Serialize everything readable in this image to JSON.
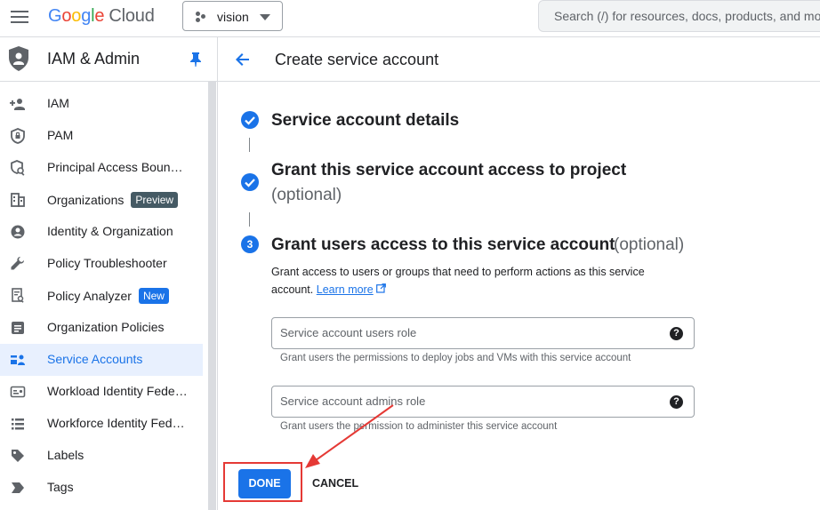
{
  "header": {
    "logo_google": [
      "G",
      "o",
      "o",
      "g",
      "l",
      "e"
    ],
    "logo_cloud": "Cloud",
    "project": "vision",
    "search_placeholder": "Search (/) for resources, docs, products, and mo"
  },
  "sidebar": {
    "title": "IAM & Admin",
    "items": [
      {
        "label": "IAM",
        "icon": "person-add-icon"
      },
      {
        "label": "PAM",
        "icon": "shield-lock-icon"
      },
      {
        "label": "Principal Access Boun…",
        "icon": "policy-icon"
      },
      {
        "label": "Organizations",
        "icon": "building-icon",
        "badge": "Preview"
      },
      {
        "label": "Identity & Organization",
        "icon": "account-circle-icon"
      },
      {
        "label": "Policy Troubleshooter",
        "icon": "wrench-icon"
      },
      {
        "label": "Policy Analyzer",
        "icon": "document-search-icon",
        "badge": "New"
      },
      {
        "label": "Organization Policies",
        "icon": "list-doc-icon"
      },
      {
        "label": "Service Accounts",
        "icon": "service-account-icon",
        "active": true
      },
      {
        "label": "Workload Identity Fede…",
        "icon": "id-card-icon"
      },
      {
        "label": "Workforce Identity Fed…",
        "icon": "list-icon"
      },
      {
        "label": "Labels",
        "icon": "tag-icon"
      },
      {
        "label": "Tags",
        "icon": "arrow-tag-icon"
      }
    ]
  },
  "main": {
    "title": "Create service account",
    "steps": [
      {
        "title": "Service account details",
        "status": "done"
      },
      {
        "title": "Grant this service account access to project",
        "optional": "(optional)",
        "status": "done"
      },
      {
        "number": "3",
        "title": "Grant users access to this service account",
        "optional": "(optional)",
        "status": "current"
      }
    ],
    "description": "Grant access to users or groups that need to perform actions as this service account.",
    "learn_more": "Learn more",
    "fields": [
      {
        "placeholder": "Service account users role",
        "hint": "Grant users the permissions to deploy jobs and VMs with this service account"
      },
      {
        "placeholder": "Service account admins role",
        "hint": "Grant users the permission to administer this service account"
      }
    ],
    "done_label": "DONE",
    "cancel_label": "CANCEL"
  },
  "colors": {
    "accent": "#1a73e8",
    "highlight": "#e53935"
  }
}
